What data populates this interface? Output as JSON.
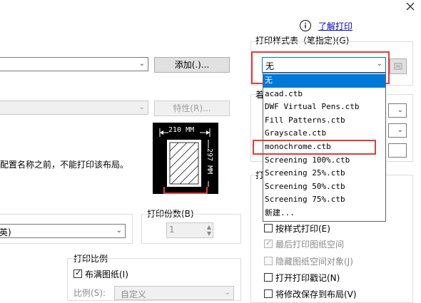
{
  "help": {
    "icon": "info-icon",
    "link_text": "了解打印"
  },
  "close_icon": "close-icon",
  "printer_row": {
    "add_button": "添加(.)..."
  },
  "properties_button": "特性(R)...",
  "paper_preview": {
    "width_label": "210 MM",
    "height_label": "297 MM"
  },
  "warning_text": "配置名称之前，不能打印该布局。",
  "copies": {
    "label": "打印份数(B)",
    "value": "1"
  },
  "left_combo_text": "英)",
  "plot_style": {
    "label": "打印样式表（笔指定)(G)",
    "selected": "无",
    "options": [
      "无",
      "acad.ctb",
      "DWF Virtual Pens.ctb",
      "Fill Patterns.ctb",
      "Grayscale.ctb",
      "monochrome.ctb",
      "Screening 100%.ctb",
      "Screening 25%.ctb",
      "Screening 50%.ctb",
      "Screening 75%.ctb",
      "新建..."
    ],
    "highlighted_option": "monochrome.ctb",
    "edit_icon": "edit-icon"
  },
  "scale": {
    "label": "打印比例",
    "fit_paper": "布满图纸(I)",
    "ratio_label": "比例(S):",
    "ratio_value": "自定义"
  },
  "options": {
    "partial_label_1": "着",
    "partial_label_2": "打",
    "print_with_styles": "按样式打印(E)",
    "last_paperspace": "最后打印图纸空间",
    "hide_paperspace": "隐藏图纸空间对象(J)",
    "stamp_on": "打开打印戳记(N)",
    "save_layout": "将修改保存到布局(V)"
  },
  "colors": {
    "highlight": "#0078d7",
    "red_box": "#e23c3c",
    "link": "#0000cc"
  }
}
